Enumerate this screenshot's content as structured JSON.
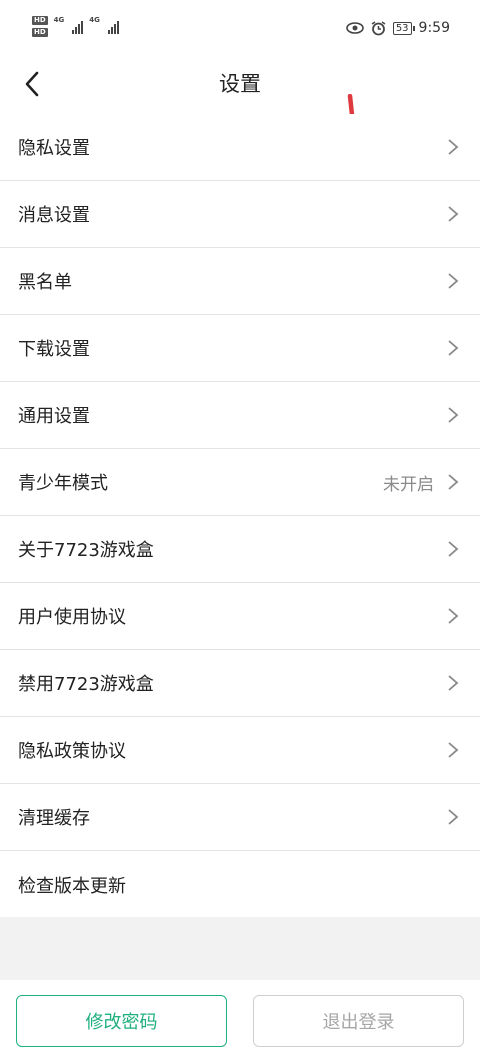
{
  "status_bar": {
    "hd1": "HD",
    "hd2": "HD",
    "net1": "4G",
    "net2": "4G",
    "battery": "53",
    "time": "9:59"
  },
  "header": {
    "title": "设置"
  },
  "menu": {
    "items": [
      {
        "label": "隐私设置"
      },
      {
        "label": "消息设置"
      },
      {
        "label": "黑名单"
      },
      {
        "label": "下载设置"
      },
      {
        "label": "通用设置"
      },
      {
        "label": "青少年模式",
        "value": "未开启"
      },
      {
        "label": "关于7723游戏盒"
      },
      {
        "label": "用户使用协议"
      },
      {
        "label": "禁用7723游戏盒"
      },
      {
        "label": "隐私政策协议"
      },
      {
        "label": "清理缓存"
      },
      {
        "label": "检查版本更新"
      }
    ]
  },
  "buttons": {
    "change_password": "修改密码",
    "logout": "退出登录"
  },
  "colors": {
    "accent": "#1fb07d",
    "annotation_arrow": "#e03a3e"
  }
}
